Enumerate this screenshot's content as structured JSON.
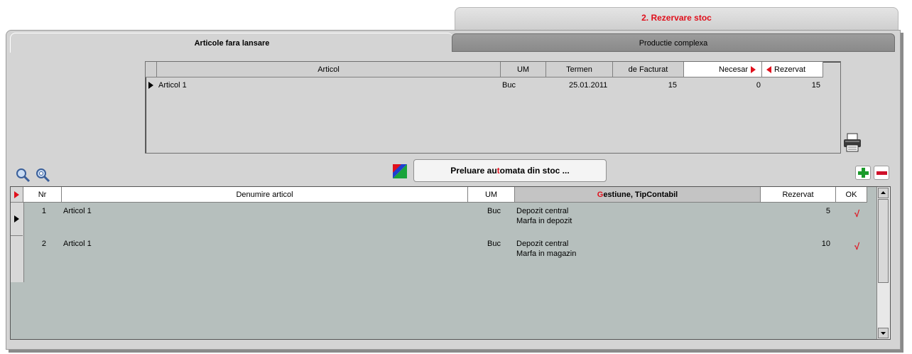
{
  "top_tab": {
    "label": "2. Rezervare stoc"
  },
  "tabs": [
    {
      "label": "Articole fara lansare",
      "active": true
    },
    {
      "label": "Productie complexa",
      "active": false
    }
  ],
  "upper_grid": {
    "columns": [
      "Articol",
      "UM",
      "Termen",
      "de Facturat",
      "Necesar",
      "Rezervat"
    ],
    "rows": [
      {
        "articol": "Articol 1",
        "um": "Buc",
        "termen": "25.01.2011",
        "de_facturat": "15",
        "necesar": "0",
        "rezervat": "15"
      }
    ]
  },
  "preluare_button": {
    "label_pre": "Preluare au",
    "label_hl": "t",
    "label_post": "omata din stoc ..."
  },
  "lower_grid": {
    "columns": {
      "nr": "Nr",
      "denumire": "Denumire articol",
      "um": "UM",
      "gestiune_hl": "G",
      "gestiune_rest": "estiune, TipContabil",
      "rezervat": "Rezervat",
      "ok": "OK"
    },
    "rows": [
      {
        "nr": "1",
        "denumire": "Articol 1",
        "um": "Buc",
        "gestiune": "Depozit central",
        "tip": "Marfa in depozit",
        "rezervat": "5",
        "ok": "√"
      },
      {
        "nr": "2",
        "denumire": "Articol 1",
        "um": "Buc",
        "gestiune": "Depozit central",
        "tip": "Marfa in magazin",
        "rezervat": "10",
        "ok": "√"
      }
    ]
  },
  "colors": {
    "accent_red": "#e0101c",
    "grid_bg": "#b6bfbd",
    "panel_bg": "#d4d4d4"
  }
}
